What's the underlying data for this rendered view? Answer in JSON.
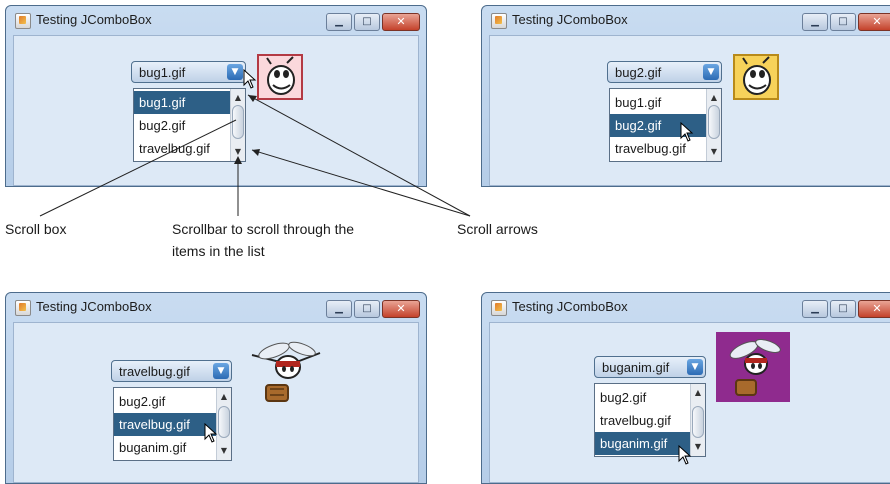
{
  "window_title": "Testing JComboBox",
  "windows": [
    {
      "selected": "bug1.gif",
      "items": [
        "bug1.gif",
        "bug2.gif",
        "travelbug.gif"
      ],
      "highlight": 0,
      "image": "bug1-face"
    },
    {
      "selected": "bug2.gif",
      "items": [
        "bug1.gif",
        "bug2.gif",
        "travelbug.gif"
      ],
      "highlight": 1,
      "image": "bug2-face"
    },
    {
      "selected": "travelbug.gif",
      "items": [
        "bug2.gif",
        "travelbug.gif",
        "buganim.gif"
      ],
      "highlight": 1,
      "image": "travelbug"
    },
    {
      "selected": "buganim.gif",
      "items": [
        "bug2.gif",
        "travelbug.gif",
        "buganim.gif"
      ],
      "highlight": 2,
      "image": "buganim"
    }
  ],
  "annotations": {
    "scroll_box": "Scroll box",
    "scrollbar_line1": "Scrollbar to scroll through the",
    "scrollbar_line2": "items in the list",
    "scroll_arrows": "Scroll arrows"
  },
  "icons": {
    "minimize": "minimize-icon",
    "maximize": "maximize-icon",
    "close": "close-icon",
    "app": "java-cup-icon"
  }
}
